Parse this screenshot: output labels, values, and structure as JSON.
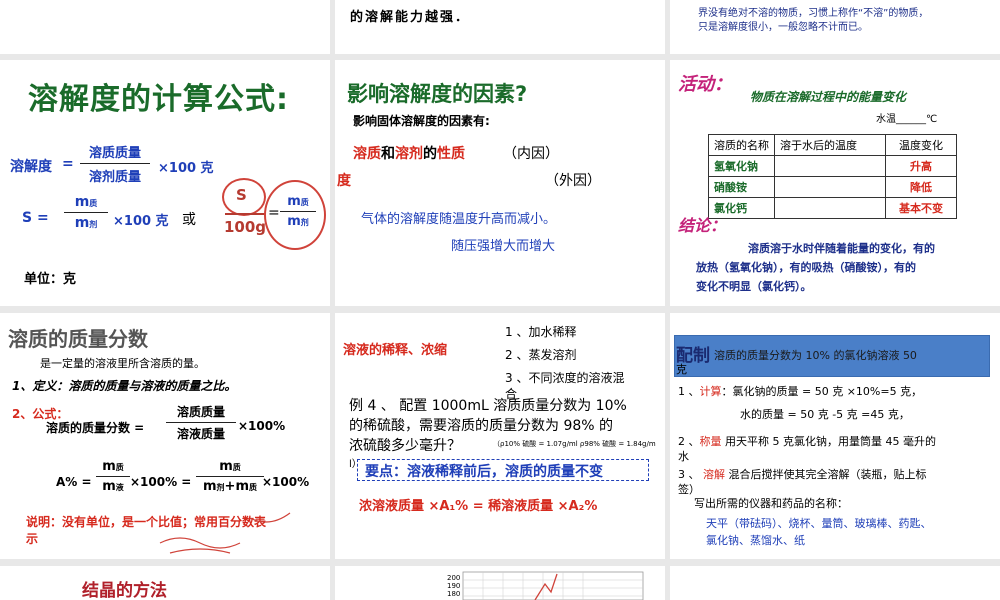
{
  "top": {
    "mid_text": "的溶解能力越强．",
    "right_line1": "界没有绝对不溶的物质，习惯上称作“不溶”的物质，",
    "right_line2": "只是溶解度很小，一般忽略不计而已。"
  },
  "s1": {
    "title": "溶解度的计算公式:",
    "lbl_solubility": "溶解度",
    "eq": "=",
    "num1": "溶质质量",
    "den1": "溶剂质量",
    "times100": "×100 克",
    "s_eq": "S =",
    "m_zhi": "m",
    "sub_zhi": "质",
    "m_ji": "m",
    "sub_ji": "剂",
    "times100b": "×100 克",
    "or": "或",
    "hand_s": "S",
    "hand_100g": "100g",
    "hand_eq": "=",
    "unit": "单位：克"
  },
  "s2": {
    "title": "影响溶解度的因素?",
    "line1": "影响固体溶解度的因素有:",
    "solute": "溶质",
    "and": "和",
    "solvent": "溶剂",
    "of": "的",
    "nature": "性质",
    "inner": "（内因）",
    "temp": "度",
    "outer": "（外因）",
    "gas1": "气体的溶解度随温度升高而减小。",
    "gas2": "随压强增大而增大"
  },
  "s3": {
    "activity": "活动：",
    "subtitle": "物质在溶解过程中的能量变化",
    "water_temp": "水温______℃",
    "headers": [
      "溶质的名称",
      "溶于水后的温度",
      "温度变化"
    ],
    "rows": [
      [
        "氢氧化钠",
        "",
        "升高"
      ],
      [
        "硝酸铵",
        "",
        "降低"
      ],
      [
        "氯化钙",
        "",
        "基本不变"
      ]
    ],
    "conclusion": "结论：",
    "c1": "溶质溶于水时伴随着能量的变化，有的",
    "c2": "放热（氢氧化钠），有的吸热（硝酸铵），有的",
    "c3": "变化不明显（氯化钙）。"
  },
  "s4": {
    "title": "溶质的质量分数",
    "line1": "是一定量的溶液里所含溶质的量。",
    "def": "1、定义：溶质的质量与溶液的质量之比。",
    "formula_lbl": "2、公式：",
    "lhs": "溶质的质量分数 =",
    "num": "溶质质量",
    "den": "溶液质量",
    "pct": "×100%",
    "a_eq": "A% =",
    "m": "m",
    "zhi": "质",
    "ye": "液",
    "ji": "剂",
    "plus": "+m",
    "pct2": "×100% =",
    "pct3": "×100%",
    "note1": "说明：没有单位，是一个比值；常用百分数表",
    "note2": "示"
  },
  "s5": {
    "title": "溶液的稀释、浓缩",
    "i1": "1 、加水稀释",
    "i2": "2 、蒸发溶剂",
    "i3": "3 、不同浓度的溶液混",
    "i3b": "合",
    "ex1": "例 4 、  配置 1000mL 溶质质量分数为 10%",
    "ex2": "的稀硫酸，需要溶质的质量分数为 98% 的",
    "ex3": "浓硫酸多少毫升？",
    "density": "（ρ10% 硫酸 = 1.07g/ml   ρ98% 硫酸 = 1.84g/m",
    "paren": "l）",
    "key": "要点：溶液稀释前后，溶质的质量不变",
    "eq": "浓溶液质量 ×A₁% = 稀溶液质量 ×A₂%"
  },
  "s6": {
    "pz": "配制",
    "head": "溶质的质量分数为 10% 的氯化钠溶液 50",
    "head2": "克",
    "n1": "1 、",
    "calc": "计算",
    "calc_t": "：氯化钠的质量 = 50 克 ×10%=5 克，",
    "water": "水的质量 = 50 克 -5 克 =45 克，",
    "n2": "2 、",
    "weigh": "称量",
    "weigh_t": "用天平称 5 克氯化钠，用量筒量 45 毫升的",
    "weigh_t2": "水",
    "n3": "3 、",
    "dissolve": "溶解",
    "dissolve_t": "混合后搅拌使其完全溶解（装瓶，贴上标",
    "dissolve_t2": "签）",
    "write": "写出所需的仪器和药品的名称：",
    "inst1": "天平（带砝码）、烧杯、量筒、玻璃棒、药匙、",
    "inst2": "氯化钠、蒸馏水、纸"
  },
  "s7": {
    "title": "结晶的方法"
  },
  "s8": {
    "ticks": [
      "200",
      "190",
      "180"
    ]
  }
}
